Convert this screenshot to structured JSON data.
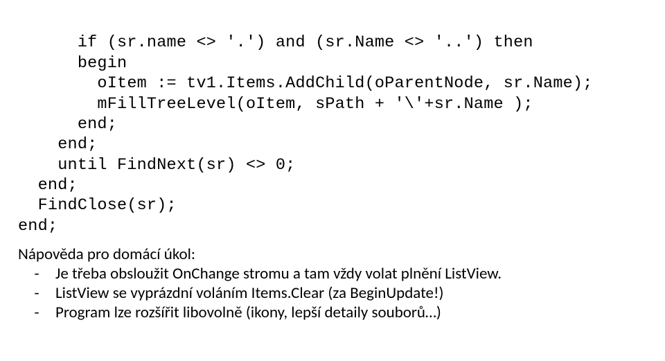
{
  "code": {
    "l1": "      if (sr.name <> '.') and (sr.Name <> '..') then",
    "l2": "      begin",
    "l3": "        oItem := tv1.Items.AddChild(oParentNode, sr.Name);",
    "l4": "        mFillTreeLevel(oItem, sPath + '\\'+sr.Name );",
    "l5": "      end;",
    "l6": "    end;",
    "l7": "    until FindNext(sr) <> 0;",
    "l8": "  end;",
    "l9": "  FindClose(sr);",
    "l10": "end;"
  },
  "prose": {
    "heading": "Nápověda pro domácí úkol:",
    "dash": "-",
    "b1": "Je třeba obsloužit OnChange stromu a tam vždy volat plnění ListView.",
    "b2": "ListView se vyprázdní voláním Items.Clear (za BeginUpdate!)",
    "b3": "Program lze rozšířit libovolně (ikony, lepší detaily souborů…)"
  }
}
